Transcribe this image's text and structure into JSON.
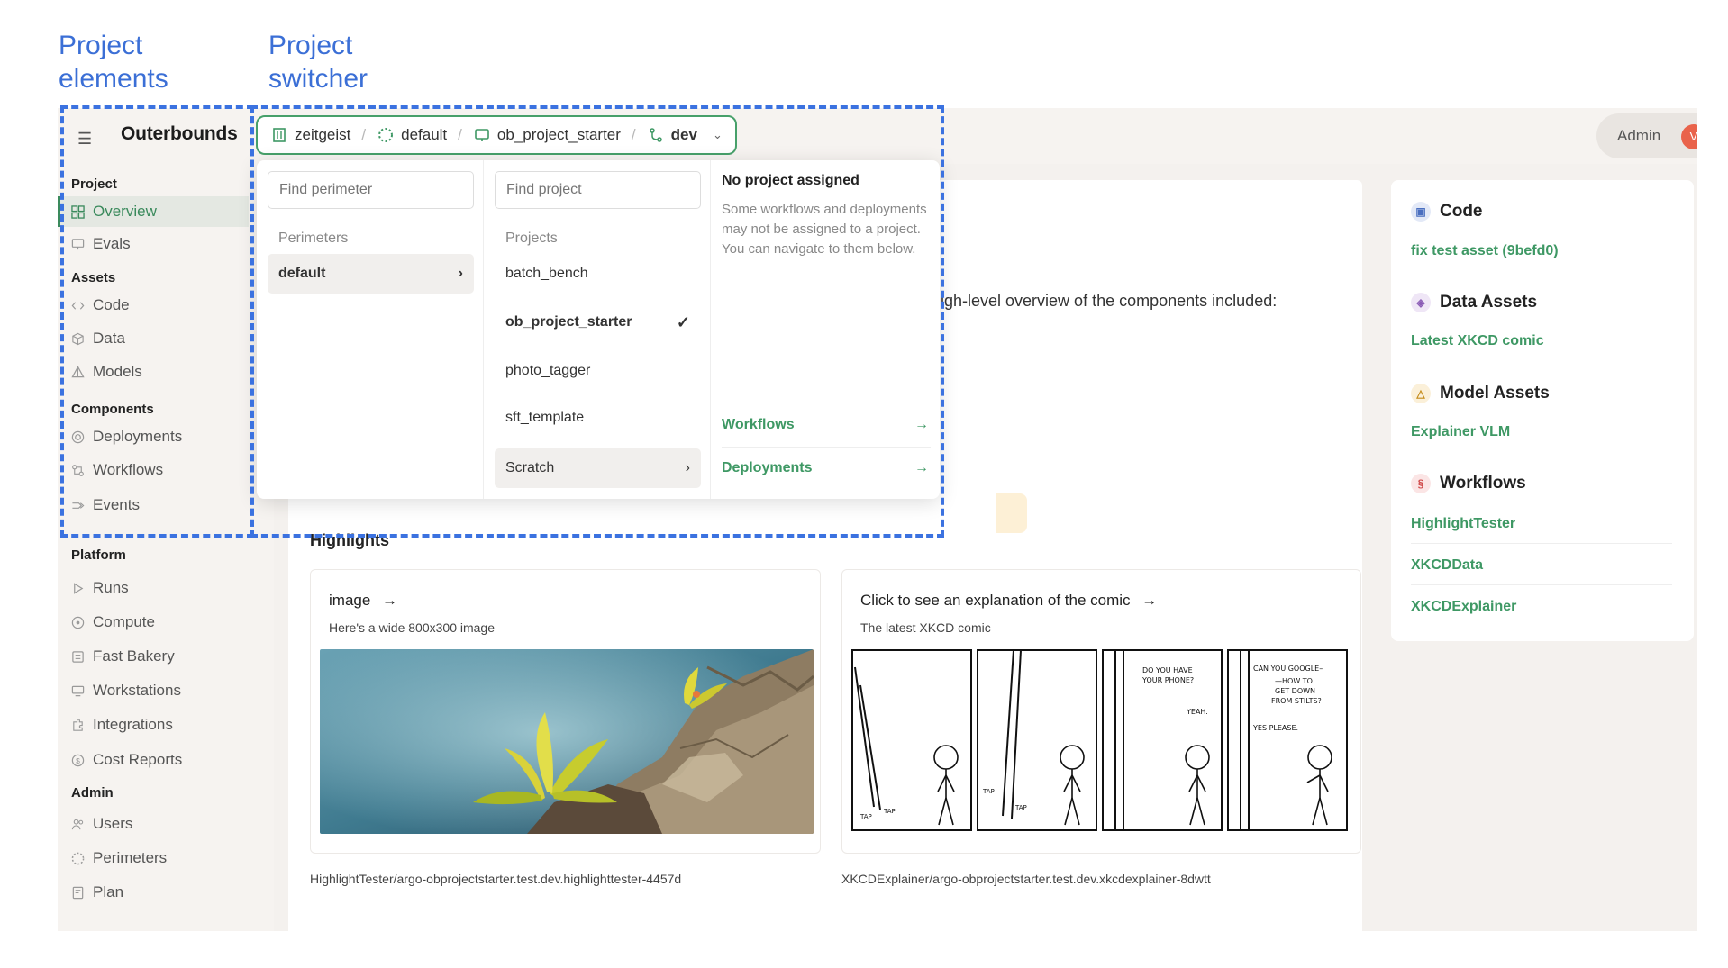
{
  "annotations": {
    "project_elements": [
      "Project",
      "elements"
    ],
    "project_switcher": [
      "Project",
      "switcher"
    ]
  },
  "app": {
    "brand": "Outerbounds",
    "admin_label": "Admin",
    "avatar_initial": "V"
  },
  "breadcrumb": {
    "perimeter": "zeitgeist",
    "namespace": "default",
    "project": "ob_project_starter",
    "branch": "dev",
    "separator": "/"
  },
  "sidebar": {
    "sections": [
      {
        "title": "Project",
        "items": [
          "Overview",
          "Evals"
        ]
      },
      {
        "title": "Assets",
        "items": [
          "Code",
          "Data",
          "Models"
        ]
      },
      {
        "title": "Components",
        "items": [
          "Deployments",
          "Workflows",
          "Events"
        ]
      },
      {
        "title": "Platform",
        "items": [
          "Runs",
          "Compute",
          "Fast Bakery",
          "Workstations",
          "Integrations",
          "Cost Reports"
        ]
      },
      {
        "title": "Admin",
        "items": [
          "Users",
          "Perimeters",
          "Plan"
        ]
      }
    ],
    "active": "Overview"
  },
  "switcher": {
    "perimeter_search_placeholder": "Find perimeter",
    "project_search_placeholder": "Find project",
    "perimeters_label": "Perimeters",
    "perimeters": [
      "default"
    ],
    "projects_label": "Projects",
    "projects": [
      "batch_bench",
      "ob_project_starter",
      "photo_tagger",
      "sft_template"
    ],
    "selected_project": "ob_project_starter",
    "scratch_label": "Scratch",
    "no_project_title": "No project assigned",
    "no_project_desc": "Some workflows and deployments may not be assigned to a project. You can navigate to them below.",
    "workflows_link": "Workflows",
    "deployments_link": "Deployments"
  },
  "main": {
    "overview_text": "igh-level overview of the components included:",
    "highlights_title": "Highlights",
    "highlights": [
      {
        "title": "image",
        "subtitle": "Here's a wide 800x300 image",
        "caption": "HighlightTester/argo-obprojectstarter.test.dev.highlighttester-4457d"
      },
      {
        "title": "Click to see an explanation of the comic",
        "subtitle": "The latest XKCD comic",
        "caption": "XKCDExplainer/argo-obprojectstarter.test.dev.xkcdexplainer-8dwtt"
      }
    ],
    "comic_text": {
      "tap": "TAP",
      "p3_q": "DO YOU HAVE YOUR PHONE?",
      "p3_a": "YEAH.",
      "p4_q": "CAN YOU GOOGLE– —HOW TO GET DOWN FROM STILTS?",
      "p4_a": "YES PLEASE."
    }
  },
  "right_panel": {
    "code_title": "Code",
    "code_link": "fix test asset (9befd0)",
    "data_title": "Data Assets",
    "data_link": "Latest XKCD comic",
    "model_title": "Model Assets",
    "model_link": "Explainer VLM",
    "workflows_title": "Workflows",
    "workflow_links": [
      "HighlightTester",
      "XKCDData",
      "XKCDExplainer"
    ]
  },
  "colors": {
    "accent_green": "#3e9864",
    "annotation_blue": "#3b72e0"
  }
}
